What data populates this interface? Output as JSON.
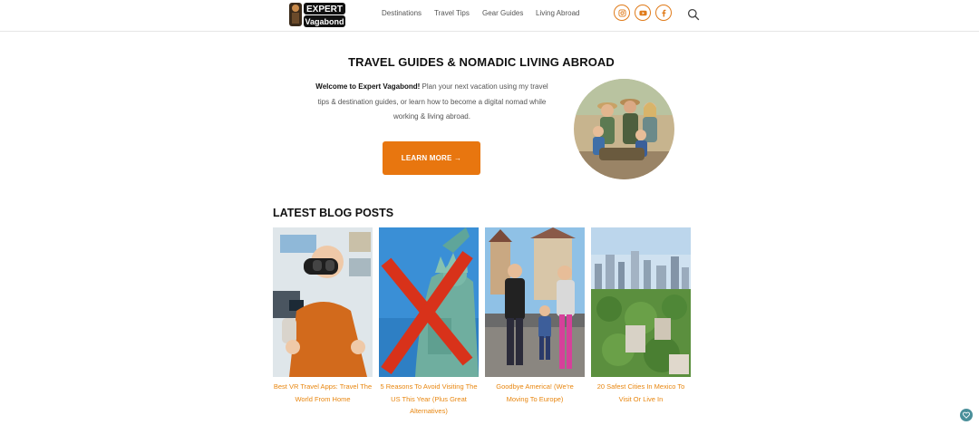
{
  "header": {
    "logo_line1": "EXPERT",
    "logo_line2": "Vagabond",
    "nav": [
      "Destinations",
      "Travel Tips",
      "Gear Guides",
      "Living Abroad"
    ],
    "social_icons": [
      "instagram-icon",
      "youtube-icon",
      "facebook-icon"
    ],
    "search_icon": "search-icon"
  },
  "hero": {
    "title": "TRAVEL GUIDES & NOMADIC LIVING ABROAD",
    "intro_bold": "Welcome to Expert Vagabond!",
    "intro_text": " Plan your next vacation using my travel tips & destination guides, or learn how to become a digital nomad while working & living abroad.",
    "cta": "LEARN MORE →"
  },
  "latest": {
    "heading": "LATEST BLOG POSTS",
    "posts": [
      {
        "title": "Best VR Travel Apps: Travel The World From Home"
      },
      {
        "title": "5 Reasons To Avoid Visiting The US This Year (Plus Great Alternatives)"
      },
      {
        "title": "Goodbye America! (We're Moving To Europe)"
      },
      {
        "title": "20 Safest Cities In Mexico To Visit Or Live In"
      }
    ]
  },
  "colors": {
    "accent": "#e8760f",
    "link": "#e8860f",
    "chat": "#4a8f9a"
  }
}
